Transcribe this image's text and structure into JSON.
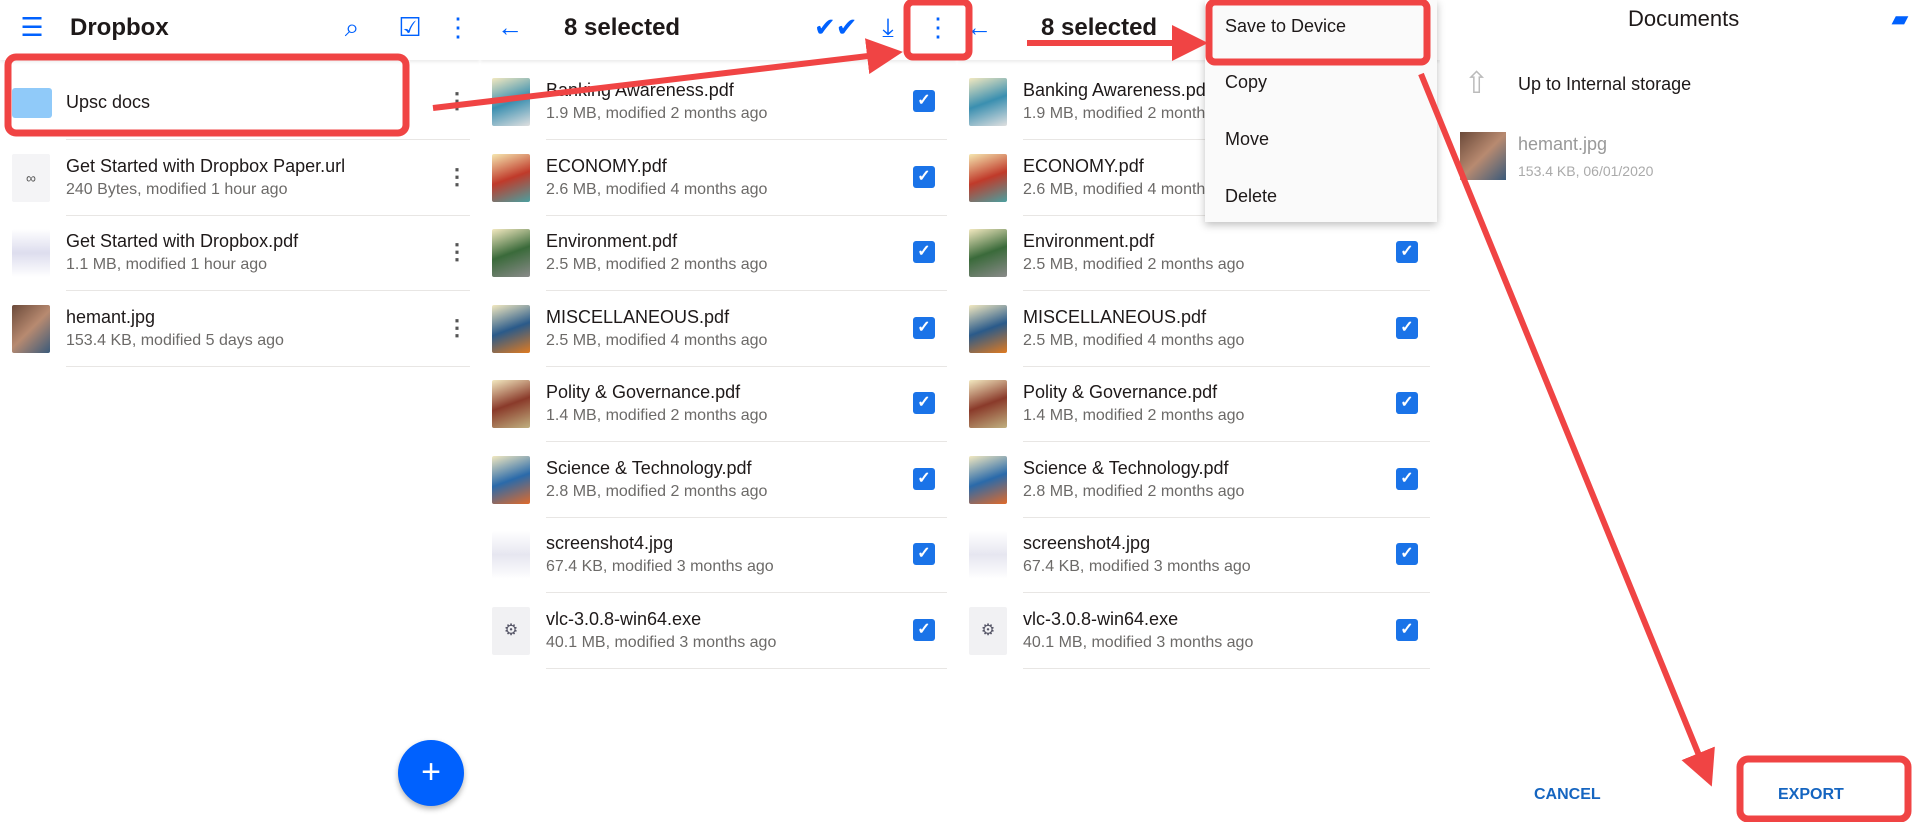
{
  "panel1": {
    "title": "Dropbox",
    "icons": [
      "menu-icon",
      "search-icon",
      "select-icon",
      "more-icon"
    ],
    "items": [
      {
        "name": "Upsc docs",
        "meta": "",
        "type": "folder"
      },
      {
        "name": "Get Started with Dropbox Paper.url",
        "meta": "240 Bytes, modified 1 hour ago",
        "type": "link"
      },
      {
        "name": "Get Started with Dropbox.pdf",
        "meta": "1.1 MB, modified 1 hour ago",
        "type": "pdf"
      },
      {
        "name": "hemant.jpg",
        "meta": "153.4 KB, modified 5 days ago",
        "type": "image"
      }
    ],
    "fab": "+"
  },
  "panel2": {
    "title": "8 selected",
    "icons": [
      "back-icon",
      "select-all-icon",
      "download-icon",
      "more-icon"
    ]
  },
  "files": [
    {
      "name": "Banking Awareness.pdf",
      "meta": "1.9 MB, modified 2 months ago"
    },
    {
      "name": "ECONOMY.pdf",
      "meta": "2.6 MB, modified 4 months ago"
    },
    {
      "name": "Environment.pdf",
      "meta": "2.5 MB, modified 2 months ago"
    },
    {
      "name": "MISCELLANEOUS.pdf",
      "meta": "2.5 MB, modified 4 months ago"
    },
    {
      "name": "Polity & Governance.pdf",
      "meta": "1.4 MB, modified 2 months ago"
    },
    {
      "name": "Science & Technology.pdf",
      "meta": "2.8 MB, modified 2 months ago"
    },
    {
      "name": "screenshot4.jpg",
      "meta": "67.4 KB, modified 3 months ago"
    },
    {
      "name": "vlc-3.0.8-win64.exe",
      "meta": "40.1 MB, modified 3 months ago"
    }
  ],
  "panel3": {
    "title": "8 selected",
    "menu": [
      "Save to Device",
      "Copy",
      "Move",
      "Delete"
    ]
  },
  "panel4": {
    "title": "Documents",
    "up": "Up to Internal storage",
    "file": {
      "name": "hemant.jpg",
      "meta": "153.4 KB, 06/01/2020"
    },
    "cancel": "CANCEL",
    "export": "EXPORT"
  },
  "colors": {
    "accent": "#0061fe",
    "checkbox": "#1a73e8",
    "annotation": "#f04444"
  }
}
